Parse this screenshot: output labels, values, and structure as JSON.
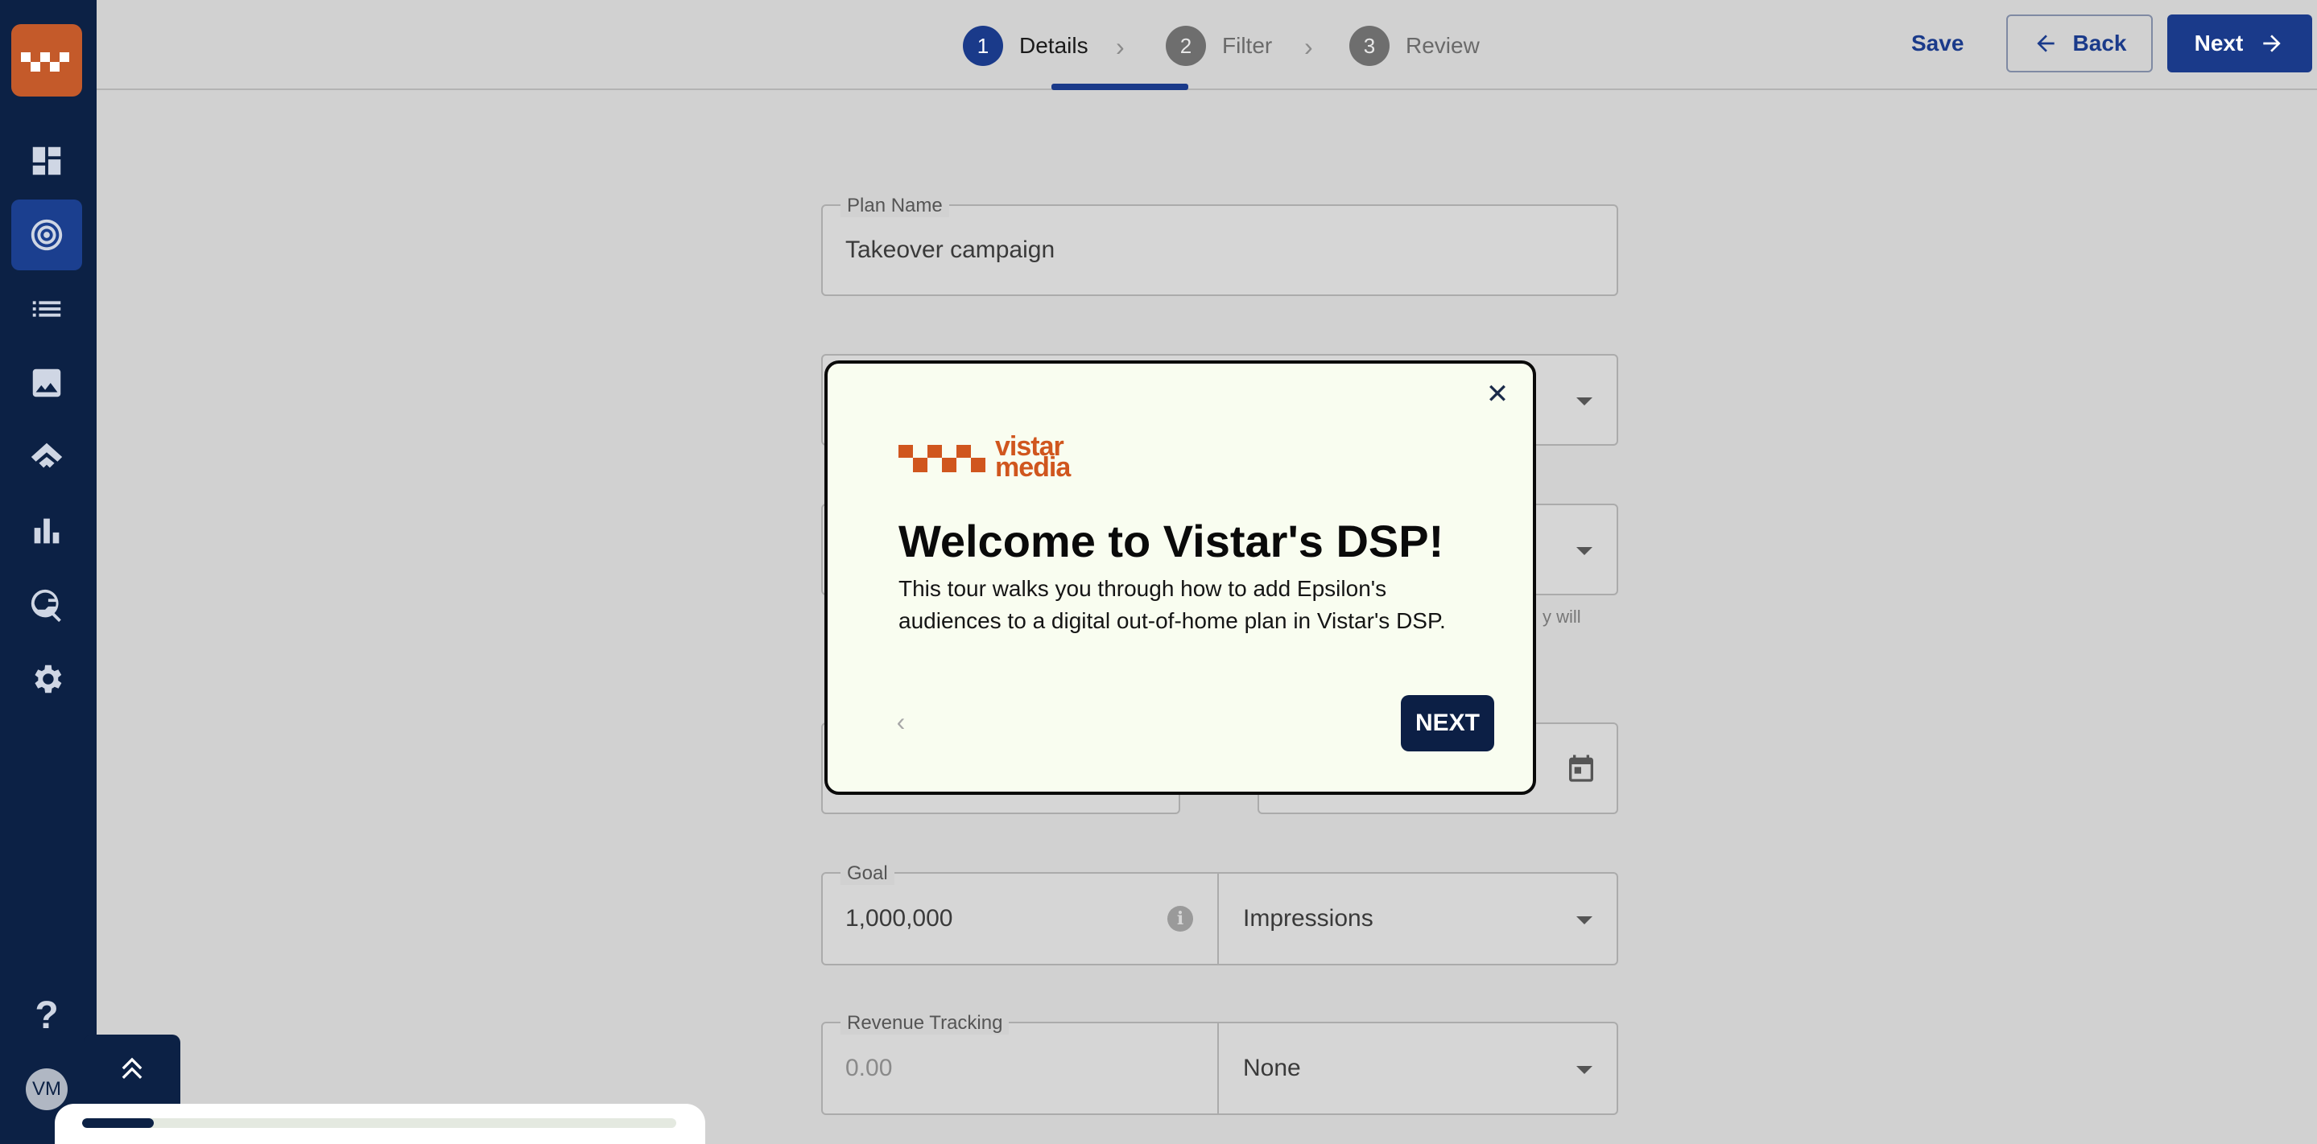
{
  "sidebar": {
    "items": [
      {
        "name": "dashboard",
        "icon": "dashboard-icon"
      },
      {
        "name": "plans",
        "icon": "target-icon",
        "active": true
      },
      {
        "name": "list",
        "icon": "list-icon"
      },
      {
        "name": "creatives",
        "icon": "image-icon"
      },
      {
        "name": "deals",
        "icon": "handshake-icon"
      },
      {
        "name": "reports",
        "icon": "bar-chart-icon"
      },
      {
        "name": "search",
        "icon": "globe-search-icon"
      },
      {
        "name": "settings",
        "icon": "gear-icon"
      }
    ],
    "help_label": "?",
    "avatar_initials": "VM"
  },
  "stepper": {
    "steps": [
      {
        "num": "1",
        "label": "Details",
        "active": true
      },
      {
        "num": "2",
        "label": "Filter"
      },
      {
        "num": "3",
        "label": "Review"
      }
    ]
  },
  "toolbar": {
    "save_label": "Save",
    "back_label": "Back",
    "next_label": "Next"
  },
  "form": {
    "plan_name": {
      "label": "Plan Name",
      "value": "Takeover campaign"
    },
    "helper_fragment": "y will",
    "goal": {
      "label": "Goal",
      "value": "1,000,000",
      "unit": "Impressions"
    },
    "revenue": {
      "label": "Revenue Tracking",
      "placeholder": "0.00",
      "type": "None"
    }
  },
  "modal": {
    "logo_line1": "vistar",
    "logo_line2": "media",
    "title": "Welcome to Vistar's DSP!",
    "body": "This tour walks you through how to add Epsilon's audiences to a digital out-of-home plan in Vistar's DSP.",
    "close_glyph": "✕",
    "prev_glyph": "‹",
    "next_label": "NEXT"
  },
  "tour_progress": 0.12,
  "colors": {
    "sidebar_bg": "#0c2145",
    "accent": "#1a3a8a",
    "brand_orange": "#d0561e",
    "modal_bg": "#f9fdf0"
  }
}
